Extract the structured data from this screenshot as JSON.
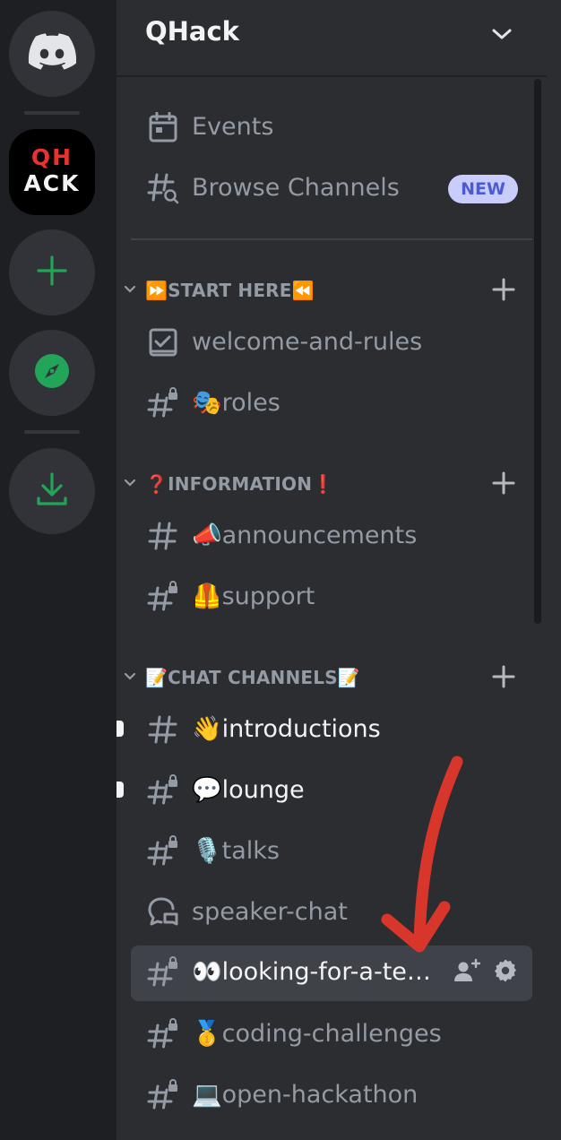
{
  "server": {
    "name": "QHack"
  },
  "rail": {
    "home_icon": "discord-logo-icon",
    "server_logo_text": [
      "QH",
      "ACK"
    ],
    "add_icon": "plus-icon",
    "explore_icon": "compass-icon",
    "download_icon": "download-icon"
  },
  "top_items": [
    {
      "label": "Events",
      "icon": "calendar-icon"
    },
    {
      "label": "Browse Channels",
      "icon": "browse-channels-icon",
      "badge": "NEW"
    }
  ],
  "categories": [
    {
      "label": "⏩START HERE⏪",
      "channels": [
        {
          "label": "welcome-and-rules",
          "icon": "rules-checkbox-icon"
        },
        {
          "label": "🎭roles",
          "icon": "locked-hash-icon"
        }
      ]
    },
    {
      "label": "❓INFORMATION❗",
      "channels": [
        {
          "label": "📣announcements",
          "icon": "hash-icon"
        },
        {
          "label": "🦺support",
          "icon": "locked-hash-icon"
        }
      ]
    },
    {
      "label": "📝CHAT CHANNELS📝",
      "channels": [
        {
          "label": "👋introductions",
          "icon": "hash-icon",
          "unread": true
        },
        {
          "label": "💬lounge",
          "icon": "locked-hash-icon",
          "unread": true
        },
        {
          "label": "🎙️talks",
          "icon": "locked-hash-icon"
        },
        {
          "label": "speaker-chat",
          "icon": "forum-icon"
        },
        {
          "label": "👀looking-for-a-te…",
          "icon": "locked-hash-icon",
          "active": true
        },
        {
          "label": "🥇coding-challenges",
          "icon": "locked-hash-icon"
        },
        {
          "label": "💻open-hackathon",
          "icon": "locked-hash-icon"
        }
      ]
    }
  ],
  "colors": {
    "rail_bg": "#1e1f22",
    "panel_bg": "#2b2d31",
    "green": "#23a559",
    "badge_bg": "#c9cdfb",
    "badge_text": "#4e5ad0",
    "annotation_arrow": "#d8362b"
  }
}
